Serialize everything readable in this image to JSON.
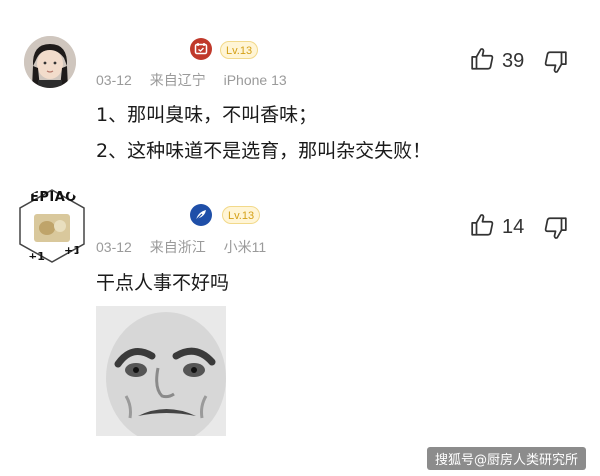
{
  "comments": [
    {
      "level": "Lv.13",
      "date": "03-12",
      "location": "来自辽宁",
      "device": "iPhone 13",
      "likes": "39",
      "lines": [
        "1、那叫臭味，不叫香味；",
        "2、这种味道不是选育，那叫杂交失败！"
      ],
      "badge_icon": "calendar-badge-icon",
      "badge_color": "#c0392b"
    },
    {
      "level": "Lv.13",
      "date": "03-12",
      "location": "来自浙江",
      "device": "小米11",
      "likes": "14",
      "lines": [
        "干点人事不好吗"
      ],
      "avatar_text": "ÉPIAO",
      "avatar_tags": [
        "+1",
        "+1"
      ],
      "badge_icon": "feather-badge-icon",
      "badge_color": "#1f4fa8",
      "sticker": "angry-face-sticker"
    }
  ],
  "watermark": "搜狐号@厨房人类研究所",
  "colors": {
    "level_text": "#d4a017",
    "meta": "#9a9a9a"
  }
}
